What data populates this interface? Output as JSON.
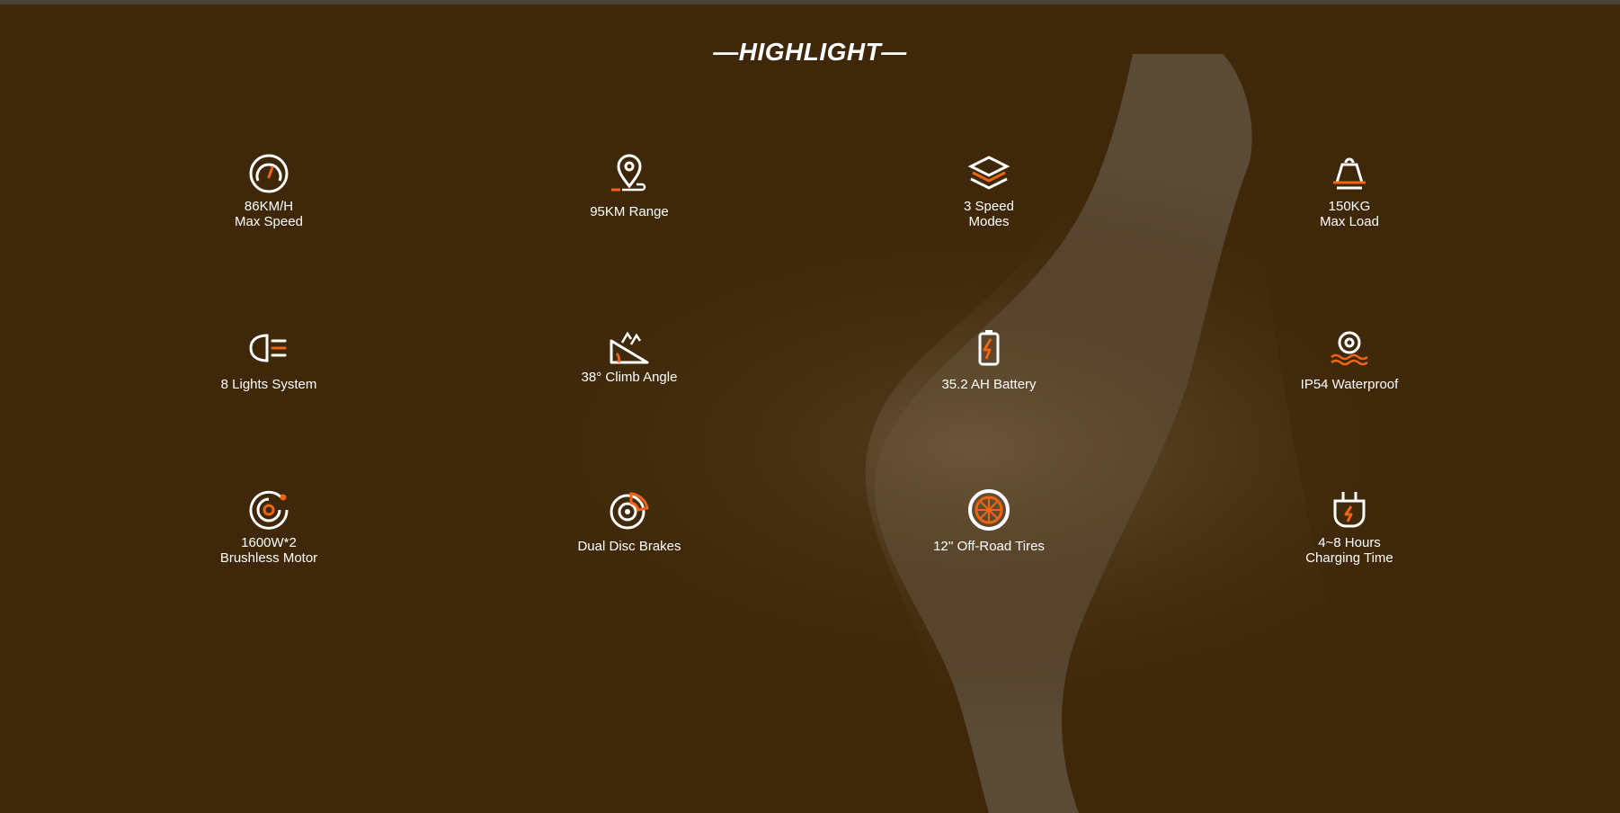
{
  "section": {
    "title": "—HIGHLIGHT—"
  },
  "colors": {
    "background": "#3e2809",
    "accent": "#f06414",
    "icon_stroke": "#ffffff"
  },
  "features": [
    {
      "icon": "speedometer-icon",
      "line1": "86KM/H",
      "line2": "Max Speed"
    },
    {
      "icon": "location-pin-icon",
      "line1": "95KM Range",
      "line2": ""
    },
    {
      "icon": "layers-icon",
      "line1": "3 Speed",
      "line2": "Modes"
    },
    {
      "icon": "weight-icon",
      "line1": "150KG",
      "line2": "Max Load"
    },
    {
      "icon": "headlight-icon",
      "line1": "8 Lights System",
      "line2": ""
    },
    {
      "icon": "climb-slope-icon",
      "line1": "38° Climb Angle",
      "line2": ""
    },
    {
      "icon": "battery-icon",
      "line1": "35.2 AH Battery",
      "line2": ""
    },
    {
      "icon": "waterproof-icon",
      "line1": "IP54 Waterproof",
      "line2": ""
    },
    {
      "icon": "motor-icon",
      "line1": "1600W*2",
      "line2": "Brushless Motor"
    },
    {
      "icon": "disc-brake-icon",
      "line1": "Dual Disc Brakes",
      "line2": ""
    },
    {
      "icon": "tire-icon",
      "line1": "12'' Off-Road Tires",
      "line2": ""
    },
    {
      "icon": "charging-plug-icon",
      "line1": "4~8 Hours",
      "line2": "Charging Time"
    }
  ]
}
